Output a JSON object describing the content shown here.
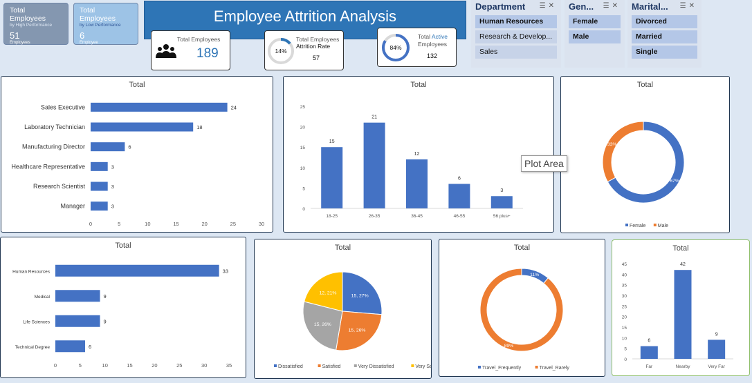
{
  "kpi_high": {
    "title": "Total Employees",
    "sub": "by High Performance",
    "value": "51",
    "unit": "Employees"
  },
  "kpi_low": {
    "title": "Total Employees",
    "sub": "by Low Performance",
    "value": "6",
    "unit": "Employee"
  },
  "dashboard_title": "Employee Attrition Analysis",
  "card_total": {
    "label": "Total Employees",
    "value": "189"
  },
  "card_attrition": {
    "line1": "Total Employees",
    "line2": "Attrition Rate",
    "pct": "14%",
    "pct_value": 0.14,
    "value": "57"
  },
  "card_active": {
    "line1a": "Total ",
    "line1b": "Active",
    "line2": "Employees",
    "pct": "84%",
    "pct_value": 0.84,
    "value": "132"
  },
  "slicers": {
    "department": {
      "header": "Department",
      "items": [
        "Human Resources",
        "Research & Develop...",
        "Sales"
      ]
    },
    "gender": {
      "header": "Gen...",
      "items": [
        "Female",
        "Male"
      ]
    },
    "marital": {
      "header": "Marital...",
      "items": [
        "Divorced",
        "Married",
        "Single"
      ]
    }
  },
  "tooltip": "Plot Area",
  "colors": {
    "blue": "#4472c4",
    "orange": "#ed7d31",
    "gray": "#a5a5a5",
    "yellow": "#ffc000",
    "banner": "#2e75b6"
  },
  "chart_data": [
    {
      "id": "jobrole",
      "type": "bar",
      "orientation": "horizontal",
      "title": "Total",
      "categories": [
        "Sales Executive",
        "Laboratory Technician",
        "Manufacturing Director",
        "Healthcare Representative",
        "Research Scientist",
        "Manager"
      ],
      "values": [
        24,
        18,
        6,
        3,
        3,
        3
      ],
      "xlim": [
        0,
        30
      ],
      "xticks": [
        "0",
        "5",
        "10",
        "15",
        "20",
        "25",
        "30"
      ]
    },
    {
      "id": "age",
      "type": "bar",
      "title": "Total",
      "categories": [
        "18-25",
        "26-35",
        "36-45",
        "46-55",
        "56 plus+"
      ],
      "values": [
        15,
        21,
        12,
        6,
        3
      ],
      "ylim": [
        0,
        25
      ],
      "yticks": [
        "0",
        "5",
        "10",
        "15",
        "20",
        "25"
      ]
    },
    {
      "id": "gender",
      "type": "pie",
      "donut": true,
      "title": "Total",
      "categories": [
        "Female",
        "Male"
      ],
      "values": [
        67,
        33
      ],
      "labels": [
        "67%",
        "33%"
      ]
    },
    {
      "id": "education",
      "type": "bar",
      "orientation": "horizontal",
      "title": "Total",
      "categories": [
        "Human Resources",
        "Medical",
        "Life Sciences",
        "Technical Degree"
      ],
      "values": [
        33,
        9,
        9,
        6
      ],
      "xlim": [
        0,
        35
      ],
      "xticks": [
        "0",
        "5",
        "10",
        "15",
        "20",
        "25",
        "30",
        "35"
      ]
    },
    {
      "id": "satisfaction",
      "type": "pie",
      "title": "Total",
      "categories": [
        "Dissatisfied",
        "Satisfied",
        "Very Dissatisfied",
        "Very Satisfied"
      ],
      "values": [
        15,
        15,
        15,
        12
      ],
      "labels": [
        "15, 27%",
        "15, 26%",
        "15, 26%",
        "12, 21%"
      ]
    },
    {
      "id": "travel",
      "type": "pie",
      "donut": true,
      "title": "Total",
      "categories": [
        "Travel_Frequently",
        "Travel_Rarely"
      ],
      "values": [
        11,
        89
      ],
      "labels": [
        "11%",
        "89%"
      ]
    },
    {
      "id": "distance",
      "type": "bar",
      "title": "Total",
      "categories": [
        "Far",
        "Nearby",
        "Very Far"
      ],
      "values": [
        6,
        42,
        9
      ],
      "ylim": [
        0,
        45
      ],
      "yticks": [
        "0",
        "5",
        "10",
        "15",
        "20",
        "25",
        "30",
        "35",
        "40",
        "45"
      ]
    }
  ]
}
